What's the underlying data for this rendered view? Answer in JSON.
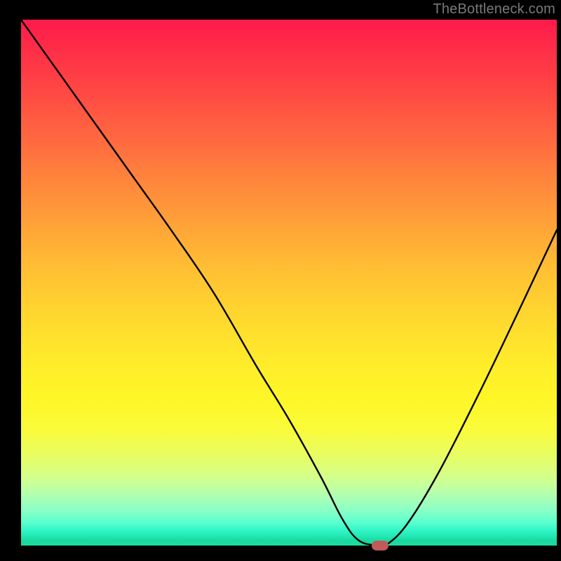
{
  "watermark": "TheBottleneck.com",
  "chart_data": {
    "type": "line",
    "title": "",
    "xlabel": "",
    "ylabel": "",
    "xlim": [
      0,
      100
    ],
    "ylim": [
      0,
      100
    ],
    "grid": false,
    "legend": false,
    "x": [
      0,
      7,
      14,
      21,
      28,
      36,
      44,
      50,
      56,
      60,
      63,
      66.5,
      68,
      72,
      78,
      86,
      94,
      100
    ],
    "values": [
      100,
      90,
      80,
      70,
      60,
      48,
      34,
      24,
      13,
      5,
      1,
      0,
      0,
      4,
      14,
      30,
      47,
      60
    ],
    "marker": {
      "x": 67,
      "y": 0
    },
    "background_gradient": {
      "top": "#ff1a4b",
      "mid": "#ffe02d",
      "bottom": "#1cd99f"
    }
  }
}
